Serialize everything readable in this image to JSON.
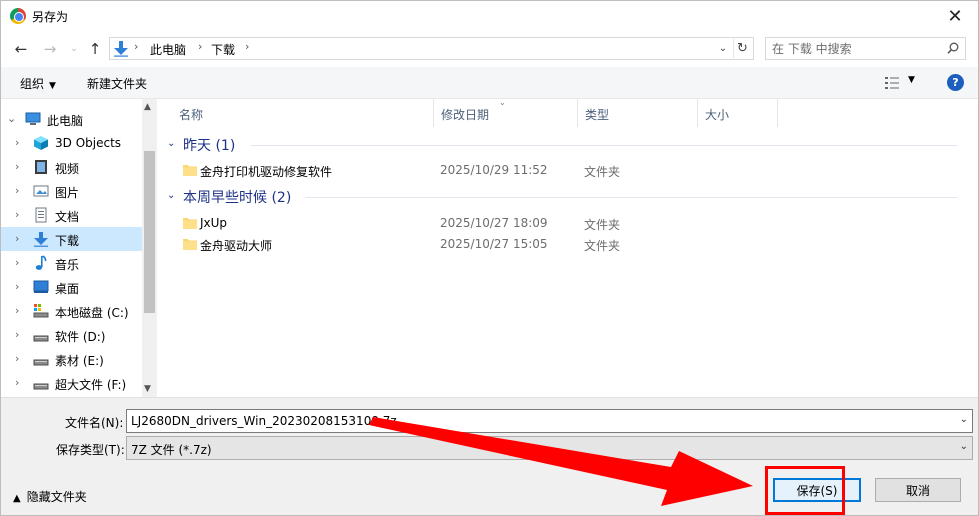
{
  "title_bar": {
    "title": "另存为",
    "close_glyph": "✕"
  },
  "address": {
    "crumbs": [
      "此电脑",
      "下载"
    ],
    "separator": "›"
  },
  "search": {
    "placeholder": "在 下载 中搜索"
  },
  "command_bar": {
    "organize": "组织",
    "new_folder": "新建文件夹"
  },
  "navigation": {
    "items": [
      {
        "label": "此电脑",
        "icon": "computer-icon",
        "root": true
      },
      {
        "label": "3D Objects",
        "icon": "3d-objects-icon"
      },
      {
        "label": "视频",
        "icon": "video-icon"
      },
      {
        "label": "图片",
        "icon": "pictures-icon"
      },
      {
        "label": "文档",
        "icon": "documents-icon"
      },
      {
        "label": "下载",
        "icon": "download-icon",
        "selected": true
      },
      {
        "label": "音乐",
        "icon": "music-icon"
      },
      {
        "label": "桌面",
        "icon": "desktop-icon"
      },
      {
        "label": "本地磁盘 (C:)",
        "icon": "local-disk-icon"
      },
      {
        "label": "软件 (D:)",
        "icon": "drive-icon"
      },
      {
        "label": "素材 (E:)",
        "icon": "drive-icon"
      },
      {
        "label": "超大文件 (F:)",
        "icon": "drive-icon"
      }
    ]
  },
  "file_list": {
    "columns": [
      "名称",
      "修改日期",
      "类型",
      "大小"
    ],
    "groups": [
      {
        "title": "昨天 (1)",
        "files": [
          {
            "name": "金舟打印机驱动修复软件",
            "date": "2025/10/29 11:52",
            "type": "文件夹"
          }
        ]
      },
      {
        "title": "本周早些时候 (2)",
        "files": [
          {
            "name": "JxUp",
            "date": "2025/10/27 18:09",
            "type": "文件夹"
          },
          {
            "name": "金舟驱动大师",
            "date": "2025/10/27 15:05",
            "type": "文件夹"
          }
        ]
      }
    ]
  },
  "form": {
    "filename_label": "文件名(N):",
    "filename_value": "LJ2680DN_drivers_Win_20230208153109.7z",
    "filetype_label": "保存类型(T):",
    "filetype_value": "7Z 文件 (*.7z)",
    "hide_folders": "隐藏文件夹",
    "save_button": "保存(S)",
    "cancel_button": "取消"
  },
  "colors": {
    "accent": "#0078d7",
    "selection": "#cce8ff",
    "group_title": "#1e3287",
    "annotation": "#ff0000"
  }
}
